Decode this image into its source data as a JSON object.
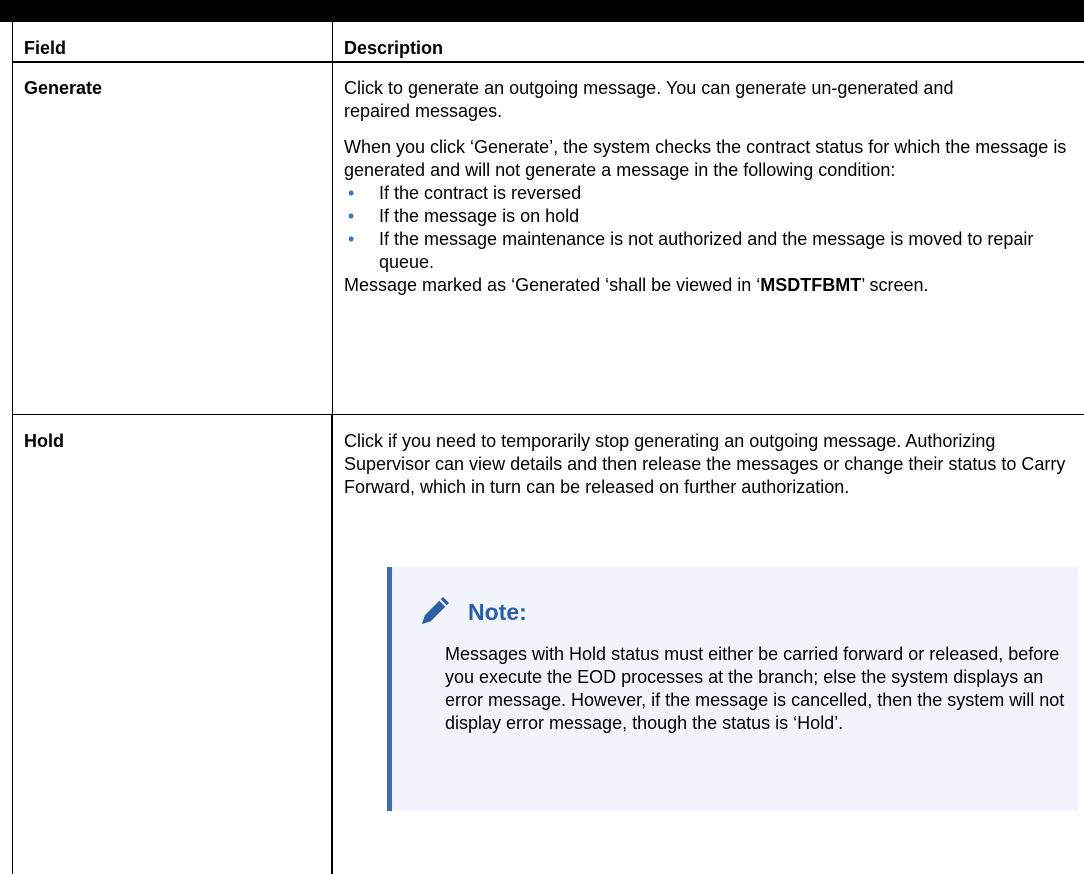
{
  "table": {
    "header": {
      "field": "Field",
      "description": "Description"
    },
    "rows": [
      {
        "field": "Generate",
        "p1": "Click to generate an outgoing message. You can generate un-generated and repaired messages.",
        "p2": "When you click ‘Generate’, the system checks the contract status for which the message is generated and will not generate a message in the following condition:",
        "bullets": [
          "If the contract is reversed",
          "If the message is on hold",
          "If the message maintenance is not authorized and the message is moved to repair queue."
        ],
        "p3_pre": "Message marked as ‘Generated ‘shall be viewed in ‘",
        "p3_bold": "MSDTFBMT",
        "p3_post": "’ screen."
      },
      {
        "field": "Hold",
        "p1": "Click if you need to temporarily stop generating an outgoing message. Authorizing Supervisor can view details and then release the messages or change their status to Carry Forward, which in turn can be released on further authorization.",
        "note": {
          "icon": "pencil-icon",
          "title": "Note:",
          "body": "Messages with Hold status must either be carried forward or released, before you execute the EOD processes at the branch; else the system displays an error message. However, if the message is cancelled, then the system will not display error message, though the status is ‘Hold’."
        }
      }
    ]
  },
  "colors": {
    "accent": "#3c6cb4",
    "note_bg": "#f1f5fb",
    "bullet": "#3a74c6"
  }
}
